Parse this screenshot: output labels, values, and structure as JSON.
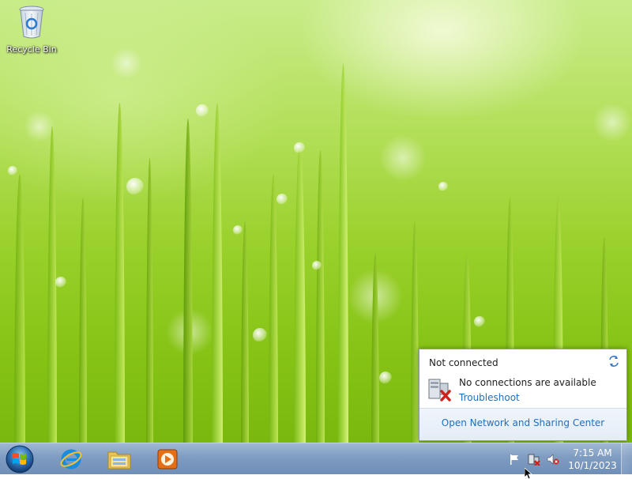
{
  "desktop": {
    "icons": [
      {
        "label": "Recycle Bin",
        "icon": "recycle-bin-icon"
      }
    ]
  },
  "network_popup": {
    "title": "Not connected",
    "status_message": "No connections are available",
    "troubleshoot_label": "Troubleshoot",
    "footer_link": "Open Network and Sharing Center"
  },
  "taskbar": {
    "start_icon": "windows-logo-icon",
    "pinned": [
      {
        "name": "internet-explorer",
        "icon": "internet-explorer-icon"
      },
      {
        "name": "windows-explorer",
        "icon": "folder-icon"
      },
      {
        "name": "media-player",
        "icon": "media-player-icon"
      }
    ],
    "tray": {
      "icons": [
        "action-center-flag-icon",
        "network-disconnected-icon",
        "volume-muted-icon"
      ],
      "time": "7:15 AM",
      "date": "10/1/2023"
    }
  },
  "colors": {
    "link": "#1e6fc0",
    "taskbar": "#7f9cc1",
    "error_red": "#d0201a"
  }
}
